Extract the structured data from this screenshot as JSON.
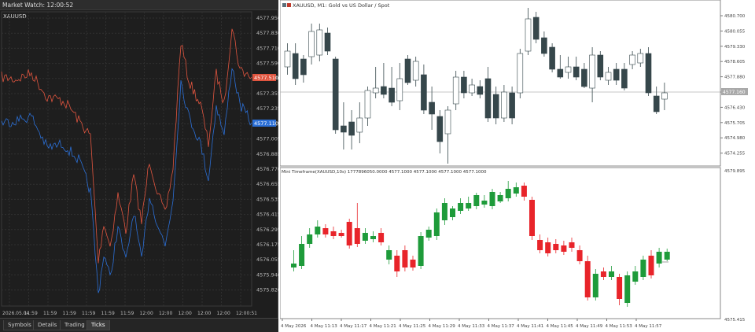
{
  "market_watch": {
    "title": "Market Watch: 12:00:52",
    "symbol": "XAUUSD",
    "price_ticks": [
      "4577.950",
      "4577.830",
      "4577.710",
      "4577.590",
      "4577.470",
      "4577.355",
      "4577.235",
      "4577.115",
      "4577.005",
      "4576.885",
      "4576.770",
      "4576.655",
      "4576.535",
      "4576.415",
      "4576.295",
      "4576.175",
      "4576.055",
      "4575.940",
      "4575.820"
    ],
    "ask_badge": "4577.510",
    "bid_badge": "4577.110",
    "time_labels": [
      "2026.05.04",
      "11:59",
      "11:59",
      "11:59",
      "11:59",
      "11:59",
      "11:59",
      "12:00",
      "12:00",
      "12:00",
      "12:00",
      "12:00",
      "12:00:51"
    ],
    "tabs": [
      "Symbols",
      "Details",
      "Trading",
      "Ticks"
    ],
    "active_tab": "Ticks",
    "colors": {
      "ask": "#e0553f",
      "bid": "#2b6fd6"
    }
  },
  "main_chart": {
    "header": "XAUUSD, M1: Gold vs US Dollar / Spot",
    "price_ticks": [
      "4580.700",
      "4580.055",
      "4579.330",
      "4578.605",
      "4577.880",
      "4577.155",
      "4576.430",
      "4575.705",
      "4574.980",
      "4574.255"
    ],
    "current_price_badge": "4577.160",
    "colors": {
      "bull": "#ffffff",
      "bear": "#36474b"
    }
  },
  "sub_chart": {
    "header": "Mini Timeframe(XAUUSD,10s) 1777896050.0000 4577.1000 4577.1000 4577.1000 4577.1000",
    "price_ticks": [
      "4579.895",
      "4575.415"
    ],
    "time_labels": [
      "4 May 2026",
      "4 May 11:13",
      "4 May 11:17",
      "4 May 11:21",
      "4 May 11:25",
      "4 May 11:29",
      "4 May 11:33",
      "4 May 11:37",
      "4 May 11:41",
      "4 May 11:45",
      "4 May 11:49",
      "4 May 11:53",
      "4 May 11:57"
    ],
    "colors": {
      "bull": "#1e9b3a",
      "bear": "#e8242a"
    }
  }
}
